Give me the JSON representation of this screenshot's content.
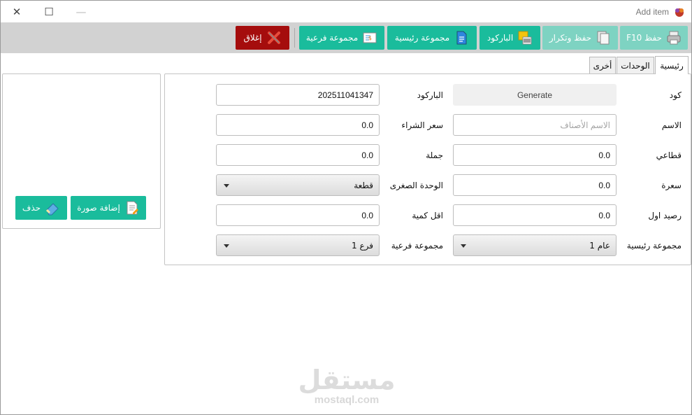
{
  "window": {
    "title": "Add item"
  },
  "toolbar": {
    "save_label": "حفظ F10",
    "save_repeat_label": "حفظ وتكرار",
    "barcode_label": "الباركود",
    "main_group_label": "مجموعة رئيسية",
    "sub_group_label": "مجموعة فرعية",
    "close_label": "إغلاق"
  },
  "tabs": [
    "رئيسية",
    "الوحدات",
    "أخرى"
  ],
  "form": {
    "code": {
      "label": "كود",
      "value": "Generate"
    },
    "barcode": {
      "label": "الباركود",
      "value": "202511041347"
    },
    "name": {
      "label": "الاسم",
      "placeholder": "الاسم الأصناف"
    },
    "purchase_price": {
      "label": "سعر الشراء",
      "value": "0.0"
    },
    "retail": {
      "label": "قطاعي",
      "value": "0.0"
    },
    "wholesale": {
      "label": "جملة",
      "value": "0.0"
    },
    "price": {
      "label": "سعرة",
      "value": "0.0"
    },
    "min_unit": {
      "label": "الوحدة الصغرى",
      "value": "قطعة"
    },
    "opening_balance": {
      "label": "رصيد اول",
      "value": "0.0"
    },
    "min_qty": {
      "label": "اقل كمية",
      "value": "0.0"
    },
    "main_group": {
      "label": "مجموعة رئيسية",
      "value": "عام 1"
    },
    "sub_group": {
      "label": "مجموعة فرعية",
      "value": "فرع 1"
    }
  },
  "image_panel": {
    "add_image_label": "إضافة صورة",
    "delete_label": "حذف"
  },
  "watermark": {
    "arabic": "مستقل",
    "english": "mostaql.com"
  }
}
